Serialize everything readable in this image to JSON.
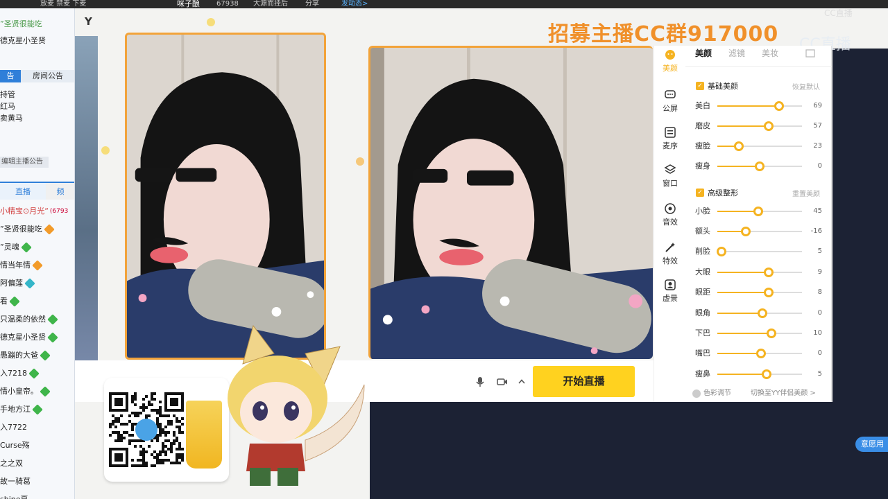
{
  "top_strip": {
    "left_text": "放麦 禁麦 下麦",
    "host_name": "咪子酿",
    "count": "67938",
    "stage_text": "大源而挂后",
    "share": "分享",
    "live_link": "发动态>"
  },
  "left_panel": {
    "top_name": "”圣贤很能吃",
    "title": "德克星小圣贤",
    "tabs": [
      "告",
      "房间公告"
    ],
    "admins": [
      "持管",
      "红马",
      "卖黄马"
    ],
    "edit_notice": "编辑主播公告",
    "chat_tabs": [
      "直播",
      "频"
    ],
    "chat_items": [
      {
        "name": "小精宝⊙月光“",
        "extra": "(6793",
        "badge": ""
      },
      {
        "name": "”圣贤很能吃",
        "badge": "orange"
      },
      {
        "name": "”灵魂",
        "badge": "green"
      },
      {
        "name": "情当年情",
        "badge": "orange"
      },
      {
        "name": "阿偏莲",
        "badge": "teal"
      },
      {
        "name": "看",
        "badge": "green"
      },
      {
        "name": "只温柔的依然",
        "badge": "green"
      },
      {
        "name": "德克星小圣贤",
        "badge": "green"
      },
      {
        "name": "愚蹦的大爸",
        "badge": "green"
      },
      {
        "name": "入7218",
        "badge": "green"
      },
      {
        "name": "情小皇帝。",
        "badge": "green"
      },
      {
        "name": "手地方江",
        "badge": "green"
      },
      {
        "name": "入7722",
        "badge": ""
      },
      {
        "name": "Curse殇",
        "badge": ""
      },
      {
        "name": "之之双",
        "badge": ""
      },
      {
        "name": "故一骑葛",
        "badge": ""
      },
      {
        "name": "shine夏",
        "badge": ""
      }
    ]
  },
  "stage": {
    "yy_label": "Y",
    "recruit_text": "招募主播CC群917000",
    "cc_logo": "CC直播",
    "watermark": "CC直播"
  },
  "controls": {
    "start_label": "开始直播",
    "mic_icon": "microphone-icon",
    "camera_icon": "camera-icon",
    "caret_icon": "caret-up-icon"
  },
  "tools": [
    {
      "label": "美颜",
      "icon": "beauty-icon",
      "color": "#f5b321"
    },
    {
      "label": "公屏",
      "icon": "chat-icon",
      "color": "#333333"
    },
    {
      "label": "麦序",
      "icon": "list-icon",
      "color": "#333333"
    },
    {
      "label": "窗口",
      "icon": "layers-icon",
      "color": "#333333"
    },
    {
      "label": "音效",
      "icon": "sound-icon",
      "color": "#333333"
    },
    {
      "label": "特效",
      "icon": "magic-icon",
      "color": "#333333"
    },
    {
      "label": "虚景",
      "icon": "virtual-bg-icon",
      "color": "#333333"
    }
  ],
  "beauty": {
    "tabs": [
      "美颜",
      "滤镜",
      "美妆"
    ],
    "basic": {
      "title": "基础美颜",
      "reset": "恢复默认",
      "sliders": [
        {
          "label": "美白",
          "value": "69",
          "level": 0.73
        },
        {
          "label": "磨皮",
          "value": "57",
          "level": 0.61
        },
        {
          "label": "瘦脸",
          "value": "23",
          "level": 0.25
        },
        {
          "label": "瘦身",
          "value": "0",
          "level": 0.5
        }
      ]
    },
    "advanced": {
      "title": "高级整形",
      "reset": "重置美颜",
      "sliders": [
        {
          "label": "小脸",
          "value": "45",
          "level": 0.48
        },
        {
          "label": "额头",
          "value": "-16",
          "level": 0.34
        },
        {
          "label": "削脸",
          "value": "5",
          "level": 0.05
        },
        {
          "label": "大眼",
          "value": "9",
          "level": 0.61
        },
        {
          "label": "眼距",
          "value": "8",
          "level": 0.61
        },
        {
          "label": "眼角",
          "value": "0",
          "level": 0.53
        },
        {
          "label": "下巴",
          "value": "10",
          "level": 0.64
        },
        {
          "label": "嘴巴",
          "value": "0",
          "level": 0.52
        },
        {
          "label": "瘦鼻",
          "value": "5",
          "level": 0.58
        }
      ]
    },
    "footer_left": "色彩调节",
    "footer_right": "切换至YY伴侣美颜 >"
  },
  "feedback": "意愿用"
}
